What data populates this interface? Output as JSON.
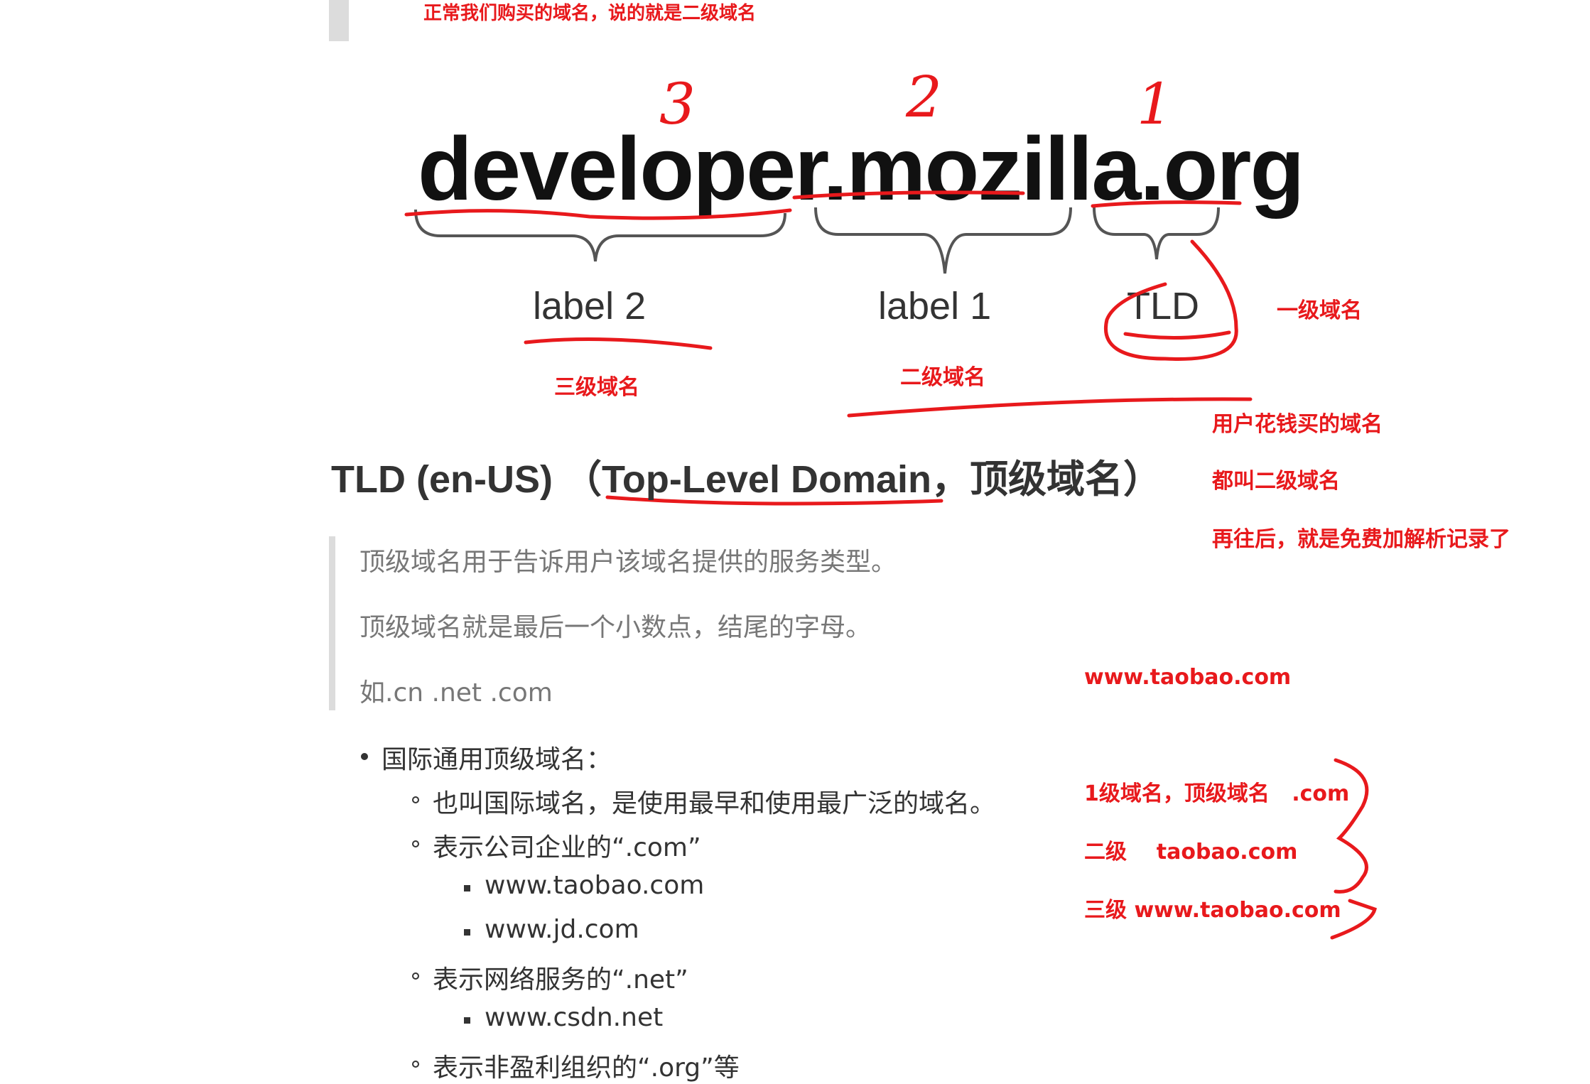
{
  "top_note": "正常我们购买的域名，说的就是二级域名",
  "diagram": {
    "domain": "developer.mozilla.org",
    "labels": [
      "label 2",
      "label 1",
      "TLD"
    ],
    "handwritten_numbers": [
      "3",
      "2",
      "1"
    ]
  },
  "annotations": {
    "first_level": "一级域名",
    "third_level": "三级域名",
    "second_level": "二级域名",
    "user_bought_1": "用户花钱买的域名",
    "user_bought_2": "都叫二级域名",
    "free_records": "再往后，就是免费加解析记录了",
    "example_domain": "www.taobao.com",
    "ex_line1": "1级域名，顶级域名   .com",
    "ex_line2": "二级    taobao.com",
    "ex_line3": "三级 www.taobao.com"
  },
  "heading": "TLD (en-US) （Top-Level Domain，顶级域名）",
  "quote": [
    "顶级域名用于告诉用户该域名提供的服务类型。",
    "顶级域名就是最后一个小数点，结尾的字母。",
    "如.cn .net .com"
  ],
  "list": {
    "item1": "国际通用顶级域名：",
    "sub1": "也叫国际域名，是使用最早和使用最广泛的域名。",
    "sub2": "表示公司企业的“.com”",
    "sub2_items": [
      "www.taobao.com",
      "www.jd.com"
    ],
    "sub3": "表示网络服务的“.net”",
    "sub3_items": [
      "www.csdn.net"
    ],
    "sub4": "表示非盈利组织的“.org”等"
  },
  "colors": {
    "annotation_red": "#e8191c",
    "quote_bar": "#dcdcdc",
    "text": "#333333",
    "quote_text": "#777777"
  }
}
